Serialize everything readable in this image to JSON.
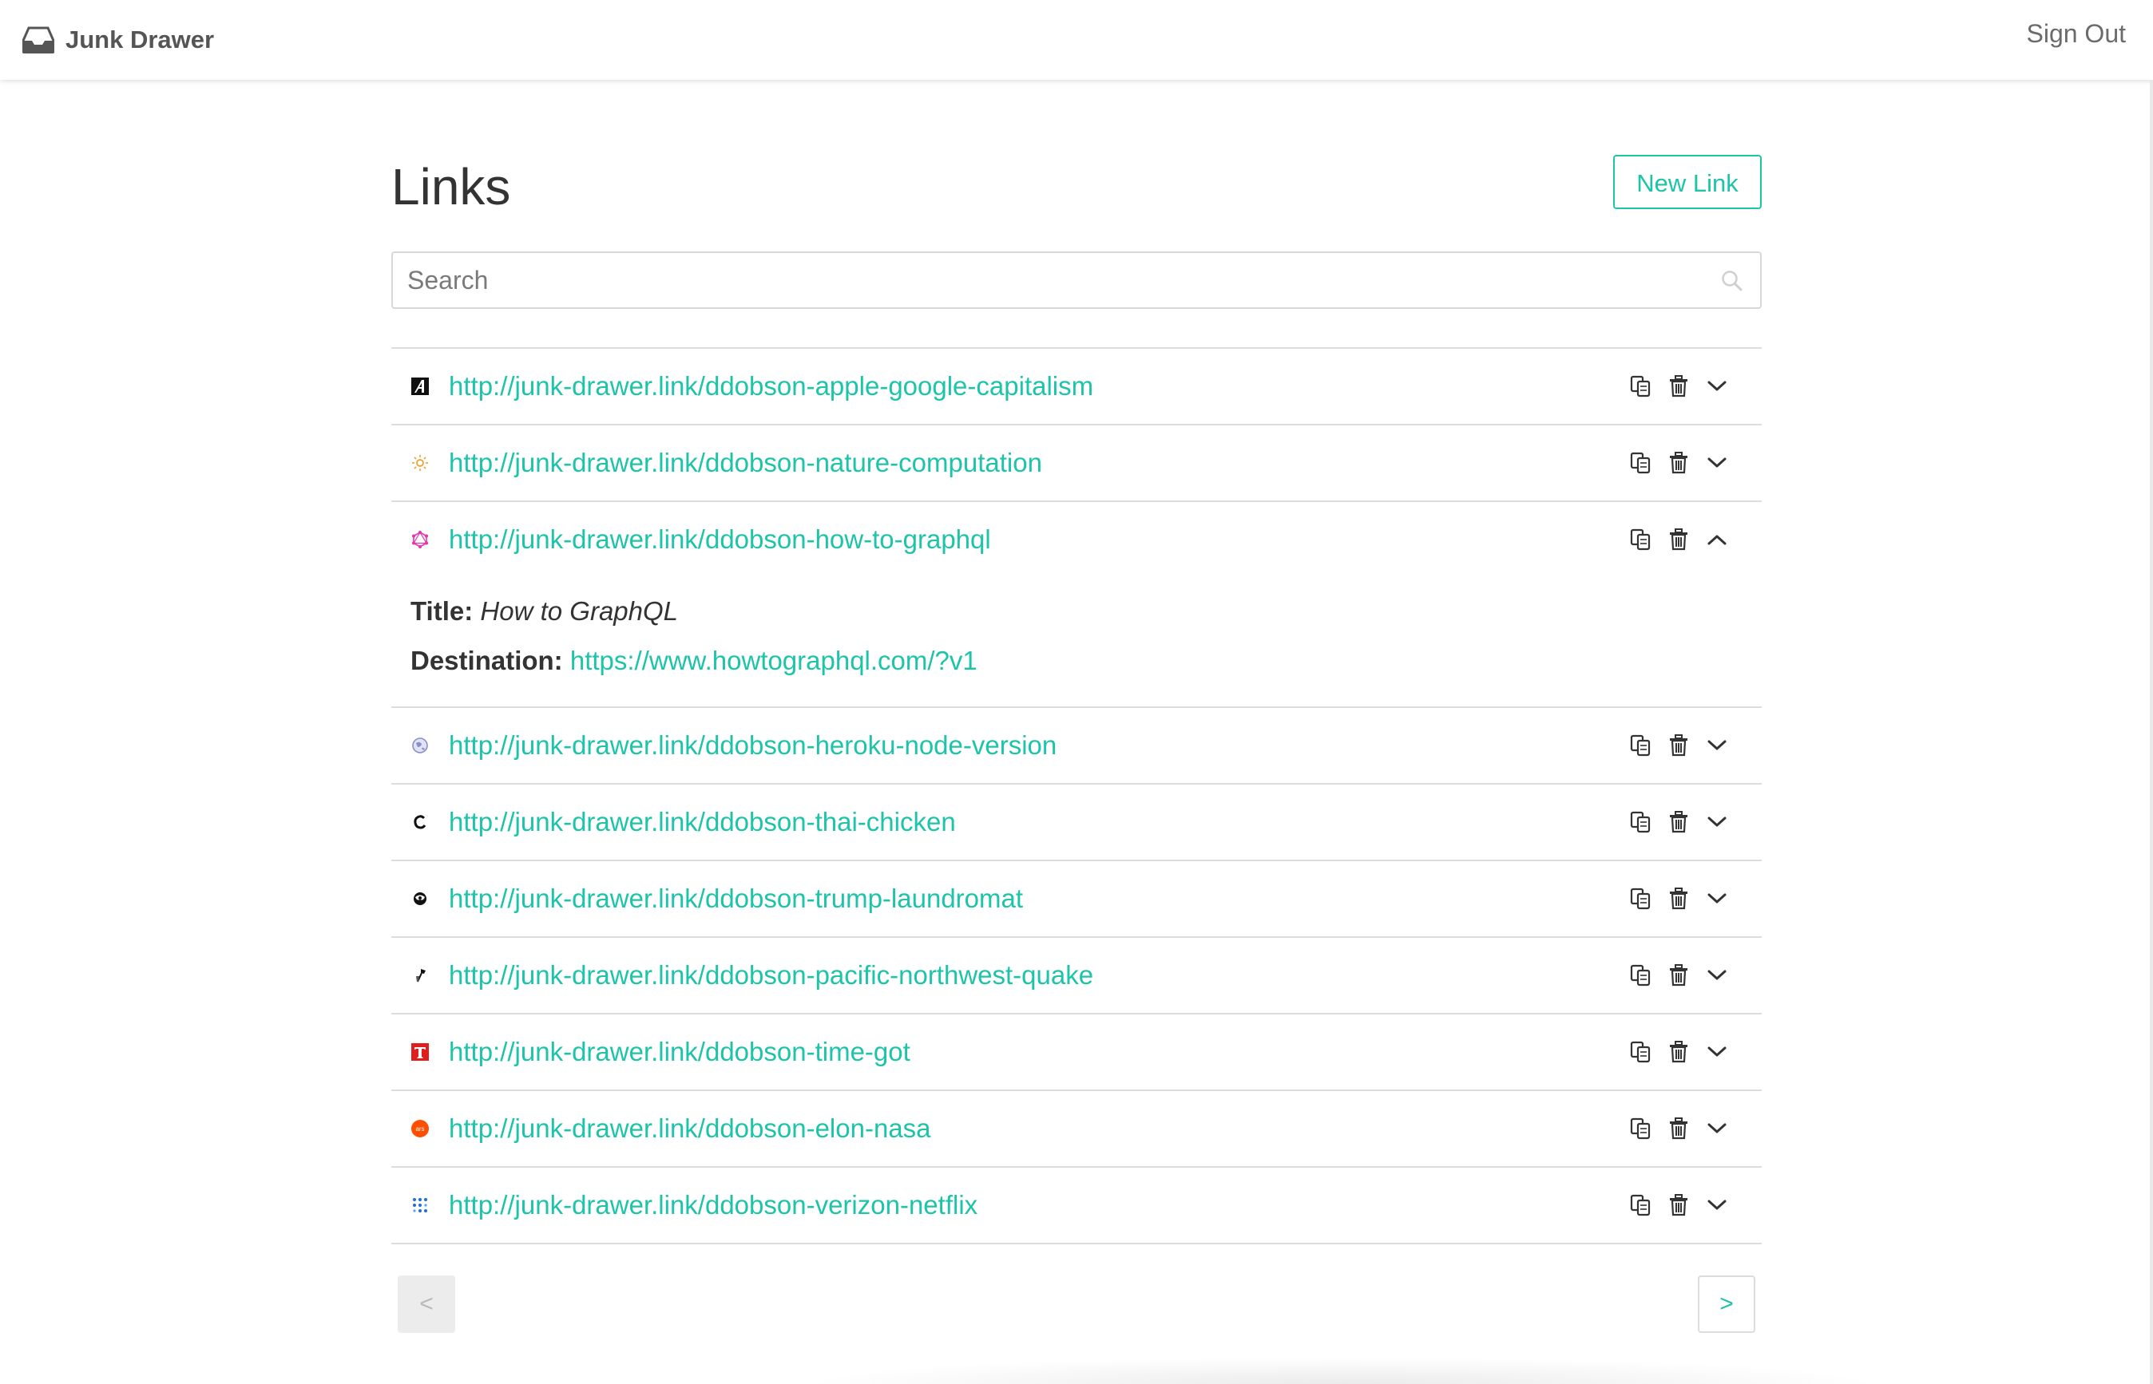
{
  "header": {
    "app_name": "Junk Drawer",
    "sign_out_label": "Sign Out"
  },
  "page": {
    "title": "Links",
    "new_link_label": "New Link"
  },
  "search": {
    "placeholder": "Search",
    "value": ""
  },
  "links": [
    {
      "url": "http://junk-drawer.link/ddobson-apple-google-capitalism",
      "favicon": "atlantic-favicon",
      "expanded": false
    },
    {
      "url": "http://junk-drawer.link/ddobson-nature-computation",
      "favicon": "sun-favicon",
      "expanded": false
    },
    {
      "url": "http://junk-drawer.link/ddobson-how-to-graphql",
      "favicon": "graphql-favicon",
      "expanded": true,
      "title_label": "Title:",
      "title_value": "How to GraphQL",
      "destination_label": "Destination:",
      "destination_value": "https://www.howtographql.com/?v1"
    },
    {
      "url": "http://junk-drawer.link/ddobson-heroku-node-version",
      "favicon": "globe-favicon",
      "expanded": false
    },
    {
      "url": "http://junk-drawer.link/ddobson-thai-chicken",
      "favicon": "c-favicon",
      "expanded": false
    },
    {
      "url": "http://junk-drawer.link/ddobson-trump-laundromat",
      "favicon": "newrepublic-favicon",
      "expanded": false
    },
    {
      "url": "http://junk-drawer.link/ddobson-pacific-northwest-quake",
      "favicon": "newyorker-favicon",
      "expanded": false
    },
    {
      "url": "http://junk-drawer.link/ddobson-time-got",
      "favicon": "time-favicon",
      "expanded": false
    },
    {
      "url": "http://junk-drawer.link/ddobson-elon-nasa",
      "favicon": "ars-favicon",
      "expanded": false
    },
    {
      "url": "http://junk-drawer.link/ddobson-verizon-netflix",
      "favicon": "dots-favicon",
      "expanded": false
    }
  ],
  "pagination": {
    "prev_label": "<",
    "next_label": ">"
  },
  "colors": {
    "accent": "#1dc4a8",
    "text": "#333333",
    "border": "#dcdcdc"
  }
}
